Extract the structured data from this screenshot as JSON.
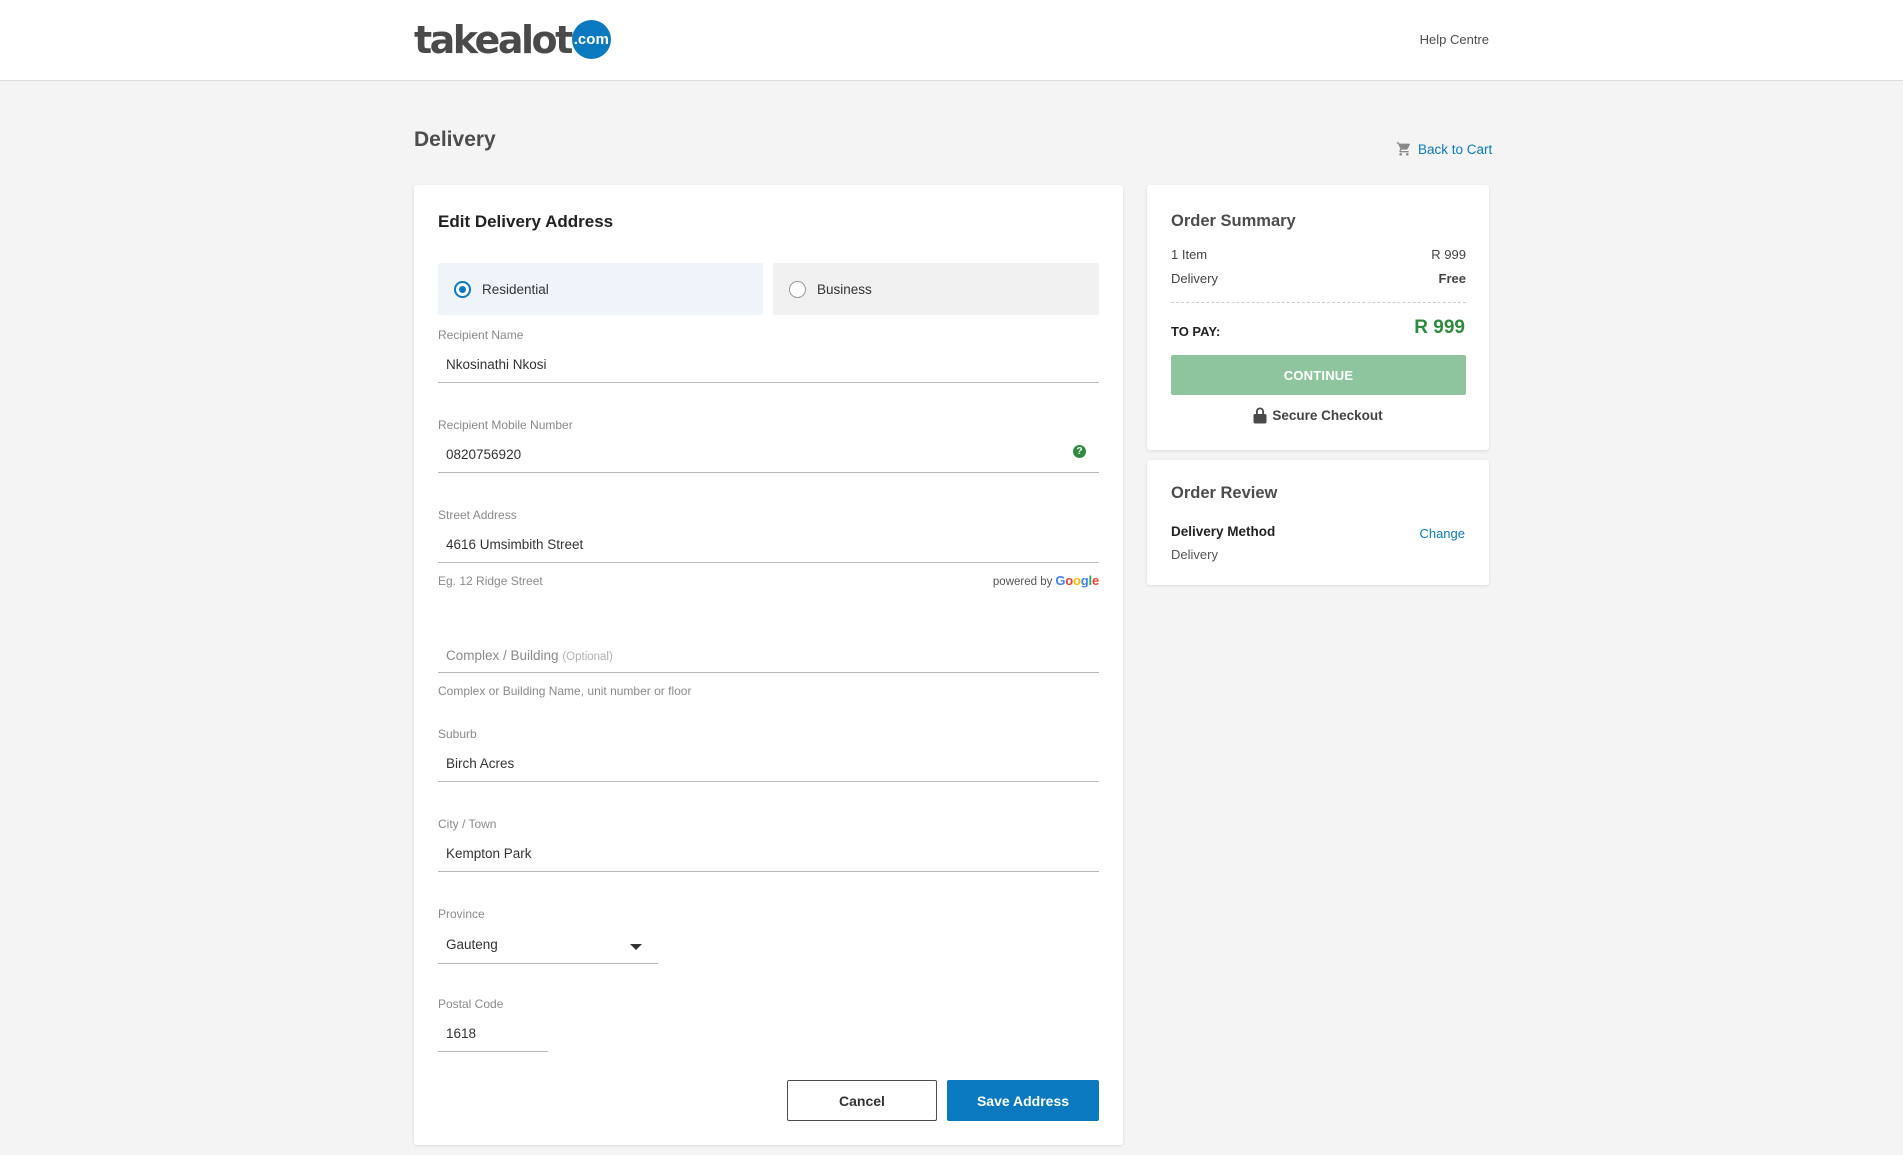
{
  "header": {
    "logo_text": "takealot",
    "logo_badge": ".com",
    "help_link": "Help Centre"
  },
  "page": {
    "title": "Delivery",
    "back_to_cart": "Back to Cart"
  },
  "form": {
    "title": "Edit Delivery Address",
    "address_types": {
      "residential": "Residential",
      "business": "Business",
      "selected": "Residential"
    },
    "recipient_name": {
      "label": "Recipient Name",
      "value": "Nkosinathi Nkosi"
    },
    "mobile": {
      "label": "Recipient Mobile Number",
      "value": "0820756920"
    },
    "street": {
      "label": "Street Address",
      "value": "4616 Umsimbith Street",
      "hint": "Eg. 12 Ridge Street",
      "powered_by": "powered by",
      "google": "Google"
    },
    "complex": {
      "placeholder": "Complex / Building",
      "optional": "(Optional)",
      "hint": "Complex or Building Name, unit number or floor"
    },
    "suburb": {
      "label": "Suburb",
      "value": "Birch Acres"
    },
    "city": {
      "label": "City / Town",
      "value": "Kempton Park"
    },
    "province": {
      "label": "Province",
      "value": "Gauteng"
    },
    "postal": {
      "label": "Postal Code",
      "value": "1618"
    },
    "cancel_label": "Cancel",
    "save_label": "Save Address"
  },
  "summary": {
    "title": "Order Summary",
    "items_label": "1 Item",
    "items_value": "R 999",
    "delivery_label": "Delivery",
    "delivery_value": "Free",
    "to_pay_label": "TO PAY:",
    "to_pay_value": "R 999",
    "continue_label": "CONTINUE",
    "secure_label": "Secure Checkout"
  },
  "review": {
    "title": "Order Review",
    "method_label": "Delivery Method",
    "method_value": "Delivery",
    "change_label": "Change"
  },
  "colors": {
    "brand_blue": "#0b79bf",
    "price_green": "#2e8b3e",
    "continue_disabled": "#8fc59e"
  },
  "icons": [
    "cart-icon",
    "help-question-icon",
    "lock-icon",
    "chevron-down-icon",
    "radio-icon"
  ]
}
